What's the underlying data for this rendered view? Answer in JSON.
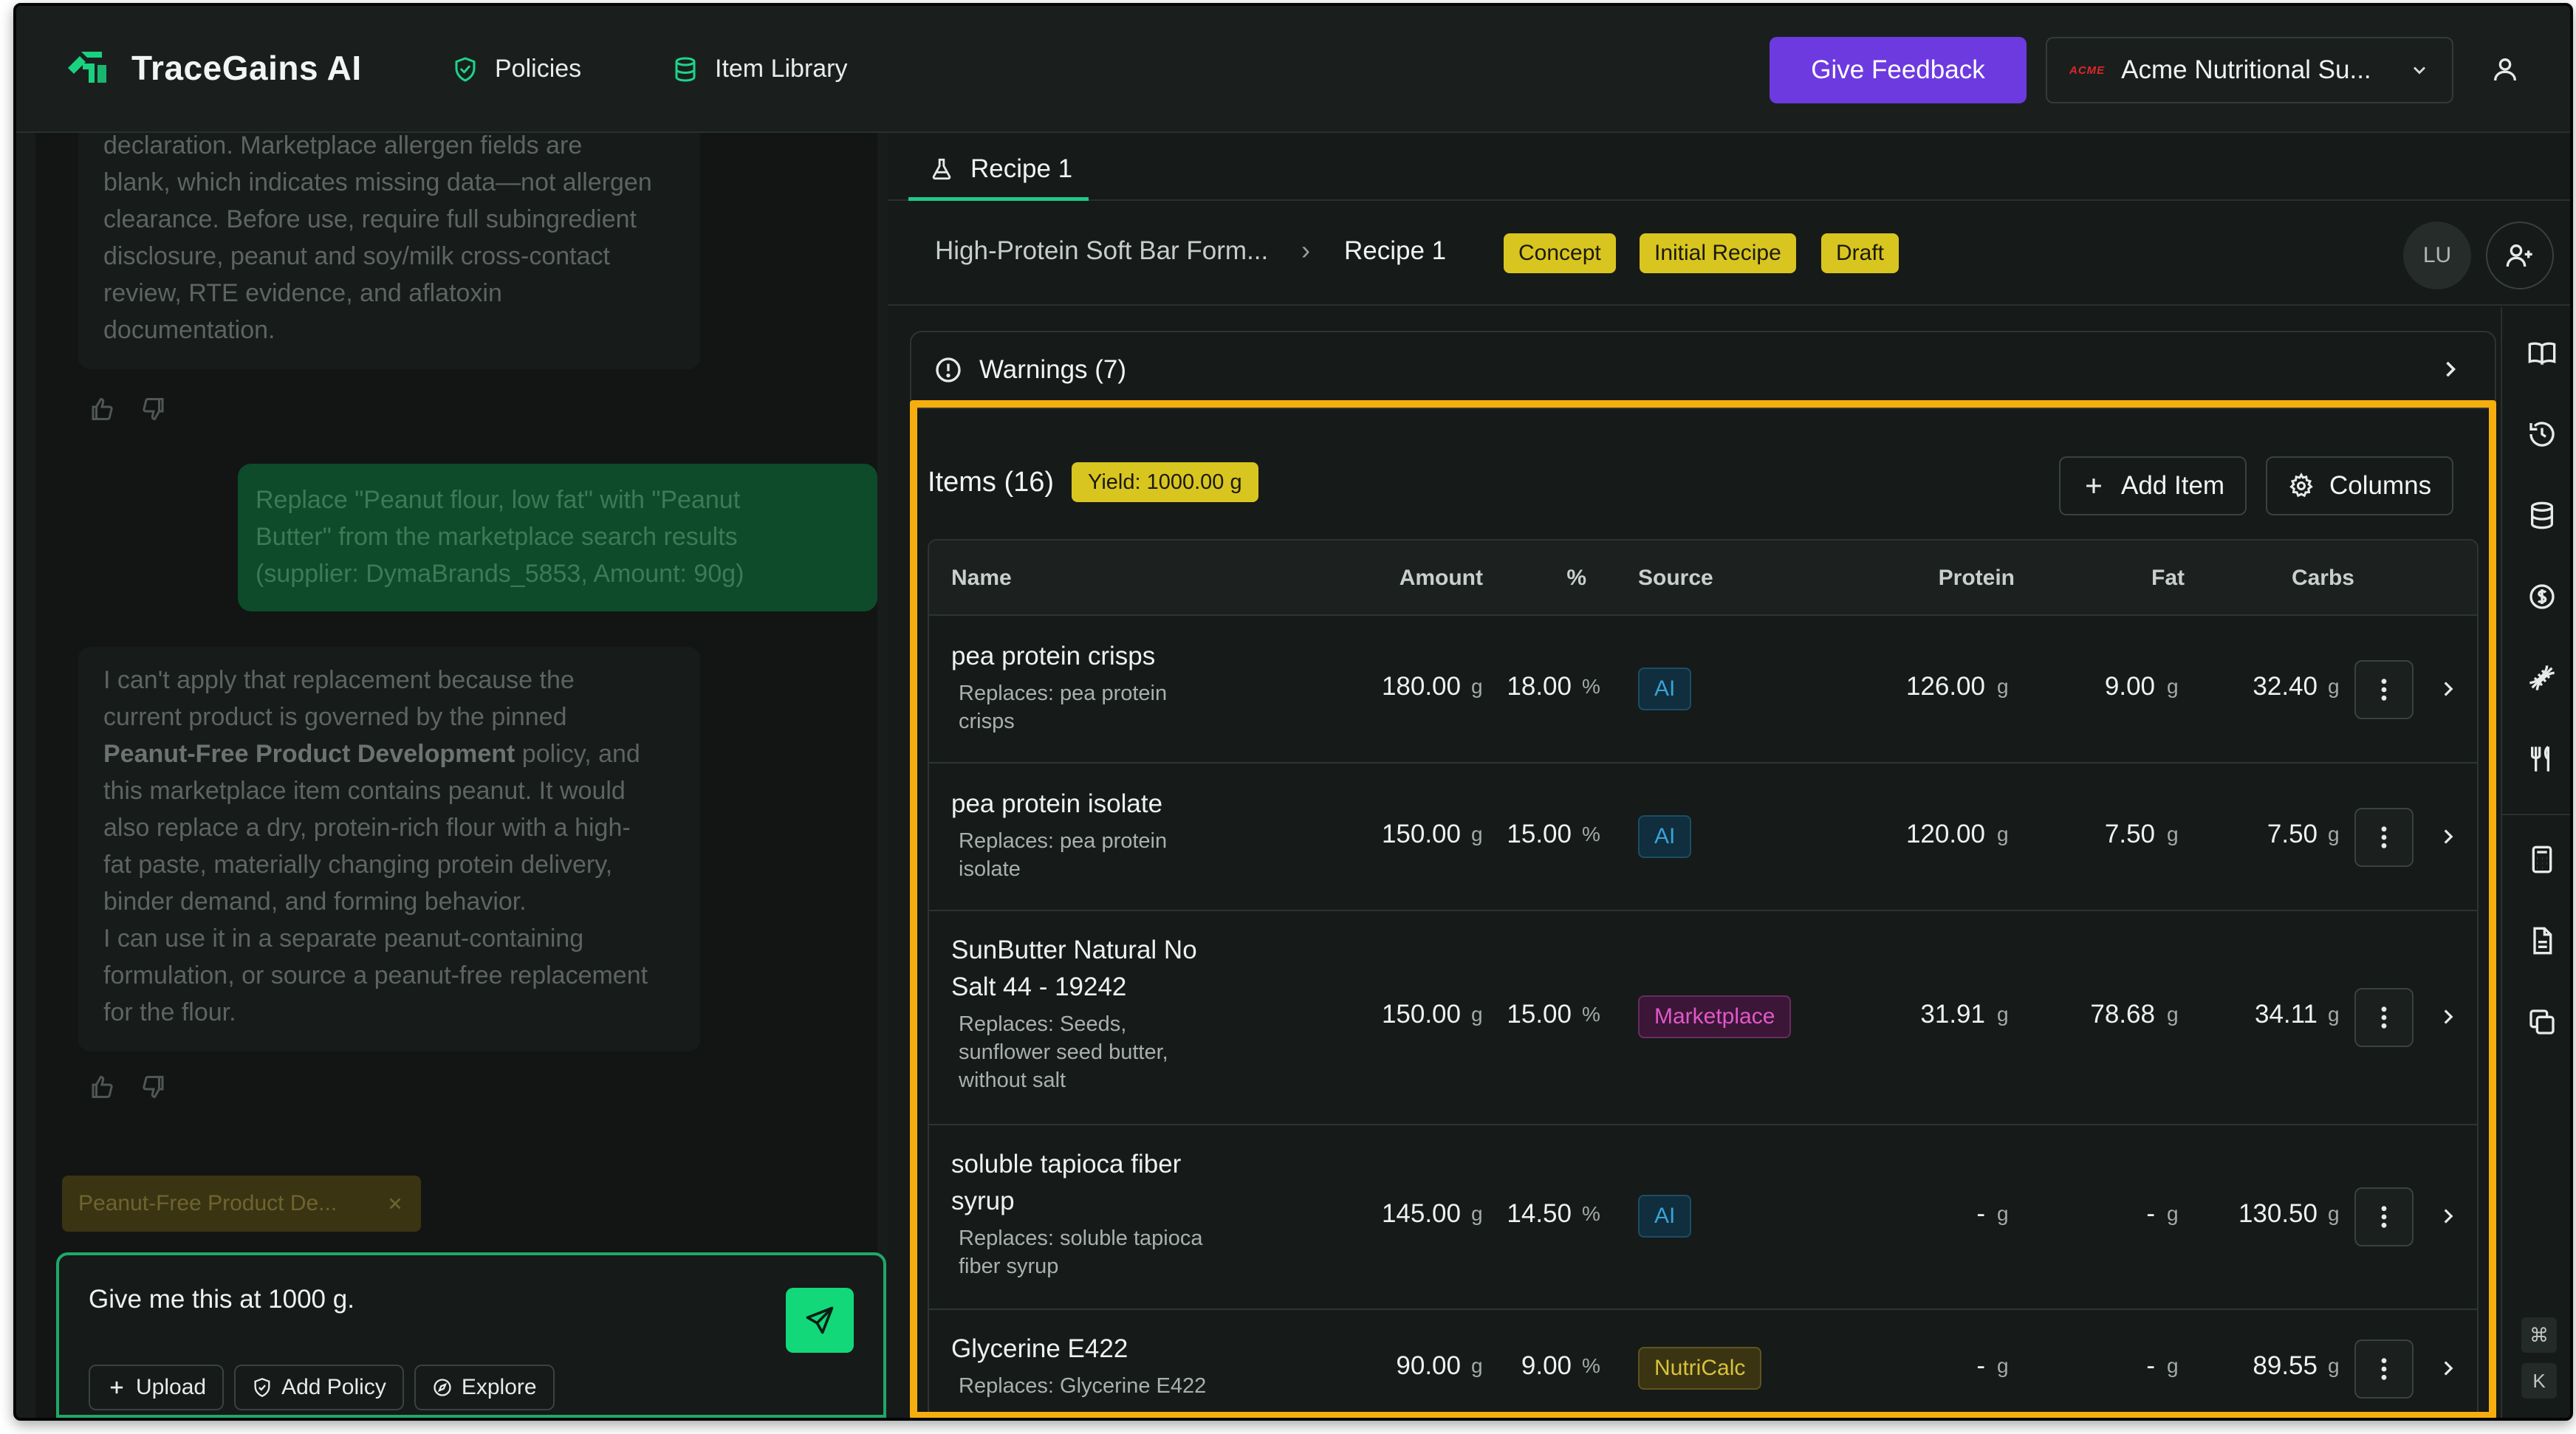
{
  "header": {
    "brand": "TraceGains AI",
    "nav": [
      {
        "label": "Policies",
        "icon": "shield-check-icon"
      },
      {
        "label": "Item Library",
        "icon": "database-icon"
      }
    ],
    "feedback_label": "Give Feedback",
    "org_logo": "ACME",
    "org_name": "Acme Nutritional Su..."
  },
  "chat": {
    "ai_message_1": [
      "declaration. Marketplace allergen fields are",
      "blank, which indicates missing data—not allergen",
      "clearance. Before use, require full subingredient",
      "disclosure, peanut and soy/milk cross-contact",
      "review, RTE evidence, and aflatoxin",
      "documentation."
    ],
    "user_message": [
      "Replace \"Peanut flour, low fat\" with \"Peanut",
      "Butter\" from the marketplace search results",
      "(supplier: DymaBrands_5853, Amount: 90g)"
    ],
    "ai_message_2": {
      "line1": "I can't apply that replacement because the",
      "line2": "current product is governed by the pinned",
      "policy_name": "Peanut-Free Product Development",
      "line3_rest": " policy, and",
      "lines_after": [
        "this marketplace item contains peanut. It would",
        "also replace a dry, protein-rich flour with a high-",
        "fat paste, materially changing protein delivery,",
        "binder demand, and forming behavior.",
        "I can use it in a separate peanut-containing",
        "formulation, or source a peanut-free replacement",
        "for the flour."
      ]
    },
    "policy_chip": "Peanut-Free Product De...",
    "composer_value": "Give me this at 1000 g.",
    "actions": [
      {
        "label": "Upload",
        "icon": "plus-icon"
      },
      {
        "label": "Add Policy",
        "icon": "shield-icon"
      },
      {
        "label": "Explore",
        "icon": "compass-icon"
      }
    ]
  },
  "recipe": {
    "tab_label": "Recipe 1",
    "breadcrumb_parent": "High-Protein Soft Bar Form...",
    "breadcrumb_current": "Recipe 1",
    "tags": [
      "Concept",
      "Initial Recipe",
      "Draft"
    ],
    "avatar": "LU",
    "warnings_label": "Warnings (7)",
    "items_title": "Items (16)",
    "yield": "Yield: 1000.00 g",
    "add_item_label": "Add Item",
    "columns_label": "Columns",
    "columns": {
      "name": "Name",
      "amount": "Amount",
      "percent": "%",
      "source": "Source",
      "protein": "Protein",
      "fat": "Fat",
      "carbs": "Carbs"
    },
    "rows": [
      {
        "name": [
          "pea protein crisps"
        ],
        "replaces": [
          "Replaces: pea protein",
          "crisps"
        ],
        "amount": "180.00",
        "amount_unit": "g",
        "percent": "18.00",
        "percent_unit": "%",
        "source": "AI",
        "protein": "126.00",
        "fat": "9.00",
        "carbs": "32.40",
        "unit": "g"
      },
      {
        "name": [
          "pea protein isolate"
        ],
        "replaces": [
          "Replaces: pea protein",
          "isolate"
        ],
        "amount": "150.00",
        "amount_unit": "g",
        "percent": "15.00",
        "percent_unit": "%",
        "source": "AI",
        "protein": "120.00",
        "fat": "7.50",
        "carbs": "7.50",
        "unit": "g"
      },
      {
        "name": [
          "SunButter Natural No",
          "Salt 44 - 19242"
        ],
        "replaces": [
          "Replaces: Seeds,",
          "sunflower seed butter,",
          "without salt"
        ],
        "amount": "150.00",
        "amount_unit": "g",
        "percent": "15.00",
        "percent_unit": "%",
        "source": "Marketplace",
        "protein": "31.91",
        "fat": "78.68",
        "carbs": "34.11",
        "unit": "g"
      },
      {
        "name": [
          "soluble tapioca fiber",
          "syrup"
        ],
        "replaces": [
          "Replaces: soluble tapioca",
          "fiber syrup"
        ],
        "amount": "145.00",
        "amount_unit": "g",
        "percent": "14.50",
        "percent_unit": "%",
        "source": "AI",
        "protein": "-",
        "fat": "-",
        "carbs": "130.50",
        "unit": "g"
      },
      {
        "name": [
          "Glycerine E422"
        ],
        "replaces": [
          "Replaces: Glycerine E422"
        ],
        "amount": "90.00",
        "amount_unit": "g",
        "percent": "9.00",
        "percent_unit": "%",
        "source": "NutriCalc",
        "protein": "-",
        "fat": "-",
        "carbs": "89.55",
        "unit": "g"
      }
    ],
    "rail_icons": [
      "book-open-icon",
      "history-icon",
      "database-icon",
      "dollar-icon",
      "dna-icon",
      "utensils-icon",
      "calculator-icon",
      "document-icon",
      "copy-icon"
    ],
    "shortcut_keys": [
      "⌘",
      "K"
    ]
  },
  "colors": {
    "accent_green": "#12d87a",
    "feedback_purple": "#6d3ae0",
    "highlight_orange": "#f6ae0e",
    "tag_yellow": "#d9c51f"
  }
}
